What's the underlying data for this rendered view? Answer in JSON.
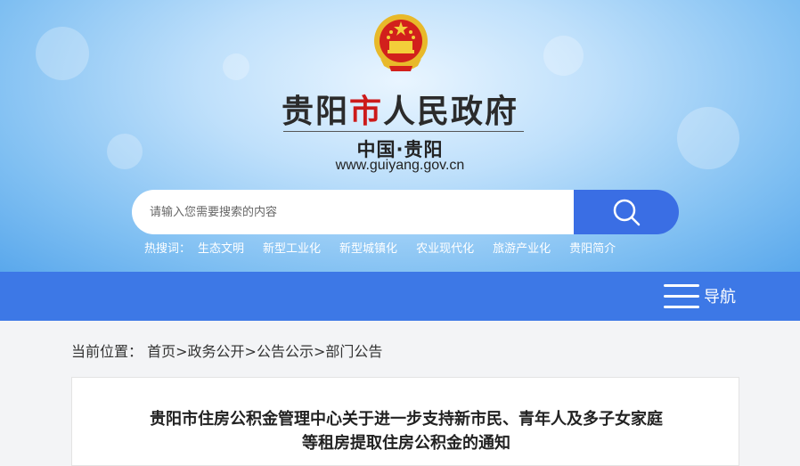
{
  "header": {
    "title_part1": "贵阳",
    "title_part2": "市",
    "title_part3": "人民政府",
    "subtitle": "中国·贵阳",
    "url": "www.guiyang.gov.cn",
    "emblem_icon": "national-emblem-icon"
  },
  "search": {
    "placeholder": "请输入您需要搜索的内容",
    "button_icon": "search-icon"
  },
  "hot_search": {
    "label": "热搜词：",
    "items": [
      "生态文明",
      "新型工业化",
      "新型城镇化",
      "农业现代化",
      "旅游产业化",
      "贵阳简介"
    ]
  },
  "nav": {
    "label": "导航",
    "icon": "menu-icon"
  },
  "breadcrumb": {
    "prefix": "当前位置：",
    "items": [
      "首页",
      "政务公开",
      "公告公示",
      "部门公告"
    ],
    "separator": ">"
  },
  "article": {
    "title_line1": "贵阳市住房公积金管理中心关于进一步支持新市民、青年人及多子女家庭",
    "title_line2": "等租房提取住房公积金的通知"
  },
  "colors": {
    "brand_blue": "#3d78e6",
    "search_button": "#3a6ee4",
    "title_red": "#cc1a1a"
  }
}
